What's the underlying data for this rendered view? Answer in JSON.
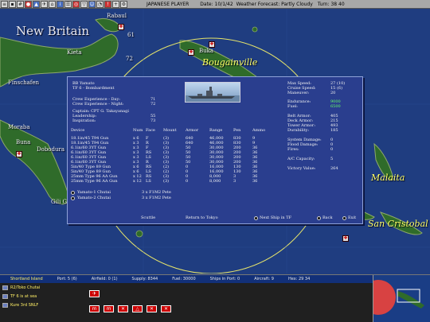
{
  "top_bar": {
    "player": "JAPANESE PLAYER",
    "date": "Date: 10/1/42",
    "weather": "Weather Forecast: Partly Cloudy",
    "turn": "Turn: 38 40"
  },
  "map_labels": {
    "new_britain": "New Britain",
    "bougainville": "Bougainville",
    "malaita": "Malaita",
    "san_cristobal": "San Cristobal",
    "rabaul": "Rabaul",
    "buka": "Buka",
    "finschafen": "Finschafen",
    "moraba": "Moraba",
    "buna": "Buna",
    "dobodura": "Dobodura",
    "gili_gili": "Gili Gili",
    "kavieng_small": "Kieta",
    "numbers": [
      "61",
      "72"
    ]
  },
  "ship": {
    "name": "BB Yamato",
    "tf": "TF 6 - Bombardment",
    "crew_day_label": "Crew Experience - Day:",
    "crew_day": "71",
    "crew_night_label": "Crew Experience - Night:",
    "crew_night": "72",
    "captain": "Captain: CPT G. Takayanagi",
    "leadership_label": "Leadership:",
    "leadership": "55",
    "inspiration_label": "Inspiration:",
    "inspiration": "73"
  },
  "stats_right": [
    {
      "label": "Max Speed:",
      "value": "27 (10)",
      "color": "#f2f2f2"
    },
    {
      "label": "Cruise Speed:",
      "value": "15 (6)",
      "color": "#f2f2f2"
    },
    {
      "label": "Maneuver:",
      "value": "20",
      "color": "#f2f2f2"
    },
    {
      "label": "Endurance:",
      "value": "9000",
      "color": "#66ff66"
    },
    {
      "label": "Fuel:",
      "value": "6500",
      "color": "#66ff66"
    },
    {
      "label": "Belt Armor:",
      "value": "405",
      "color": "#f2f2f2"
    },
    {
      "label": "Deck Armor:",
      "value": "215",
      "color": "#f2f2f2"
    },
    {
      "label": "Tower Armor:",
      "value": "493",
      "color": "#f2f2f2"
    },
    {
      "label": "Durability:",
      "value": "185",
      "color": "#f2f2f2"
    },
    {
      "label": "System Damage:",
      "value": "0",
      "color": "#f2f2f2"
    },
    {
      "label": "Flood Damage:",
      "value": "0",
      "color": "#f2f2f2"
    },
    {
      "label": "Fires:",
      "value": "0",
      "color": "#f2f2f2"
    },
    {
      "label": "A/C Capacity:",
      "value": "5",
      "color": "#f2f2f2"
    },
    {
      "label": "Victory Value:",
      "value": "264",
      "color": "#f2f2f2"
    }
  ],
  "weapons_headers": [
    "Device",
    "Num",
    "Face",
    "Mount",
    "Armor",
    "Range",
    "Pen",
    "Ammo"
  ],
  "weapons": [
    [
      "18.1in/45 T94 Gun",
      "x 6",
      "F",
      "(3)",
      "640",
      "46,000",
      "830",
      "9"
    ],
    [
      "18.1in/45 T94 Gun",
      "x 3",
      "R",
      "(3)",
      "640",
      "46,000",
      "830",
      "9"
    ],
    [
      "6.1in/60 3YT Gun",
      "x 3",
      "F",
      "(3)",
      "50",
      "30,000",
      "200",
      "36"
    ],
    [
      "6.1in/60 3YT Gun",
      "x 3",
      "RS",
      "(3)",
      "50",
      "30,000",
      "200",
      "36"
    ],
    [
      "6.1in/60 3YT Gun",
      "x 3",
      "LS",
      "(3)",
      "50",
      "30,000",
      "200",
      "36"
    ],
    [
      "6.1in/60 3YT Gun",
      "x 3",
      "R",
      "(3)",
      "50",
      "30,000",
      "200",
      "36"
    ],
    [
      "5in/40 Type 89 Gun",
      "x 6",
      "RS",
      "(2)",
      "0",
      "16,000",
      "130",
      "36"
    ],
    [
      "5in/40 Type 89 Gun",
      "x 6",
      "LS",
      "(2)",
      "0",
      "16,000",
      "130",
      "36"
    ],
    [
      "25mm Type 96 AA Gun",
      "x 12",
      "RS",
      "(3)",
      "0",
      "8,000",
      "3",
      "36"
    ],
    [
      "25mm Type 96 AA Gun",
      "x 12",
      "LS",
      "(3)",
      "0",
      "8,000",
      "3",
      "36"
    ]
  ],
  "aircraft": [
    {
      "name": "Yamato-1 Chutai",
      "count": "3 x F1M2 Pete"
    },
    {
      "name": "Yamato-2 Chutai",
      "count": "3 x F1M2 Pete"
    }
  ],
  "buttons": {
    "scuttle": "Scuttle",
    "return": "Return to Tokyo",
    "next_ship": "Next Ship in TF",
    "back": "Back",
    "exit": "Exit"
  },
  "info_bar": {
    "base": "Shortland Island",
    "port": "Port: 5 (6)",
    "airfield": "Airfield: 0 (1)",
    "supply": "Supply: 8344",
    "fuel": "Fuel: 30000",
    "ships": "Ships in Port: 0",
    "aircraft": "Aircraft: 9",
    "hex": "Hex: 29 34"
  },
  "units": [
    "R2/Toko Chutai",
    "TF 6 is at sea",
    "Kure 3rd SNLF"
  ],
  "commands": [
    "✈",
    "m",
    "m",
    "✕",
    "△",
    "✕",
    "✕"
  ]
}
